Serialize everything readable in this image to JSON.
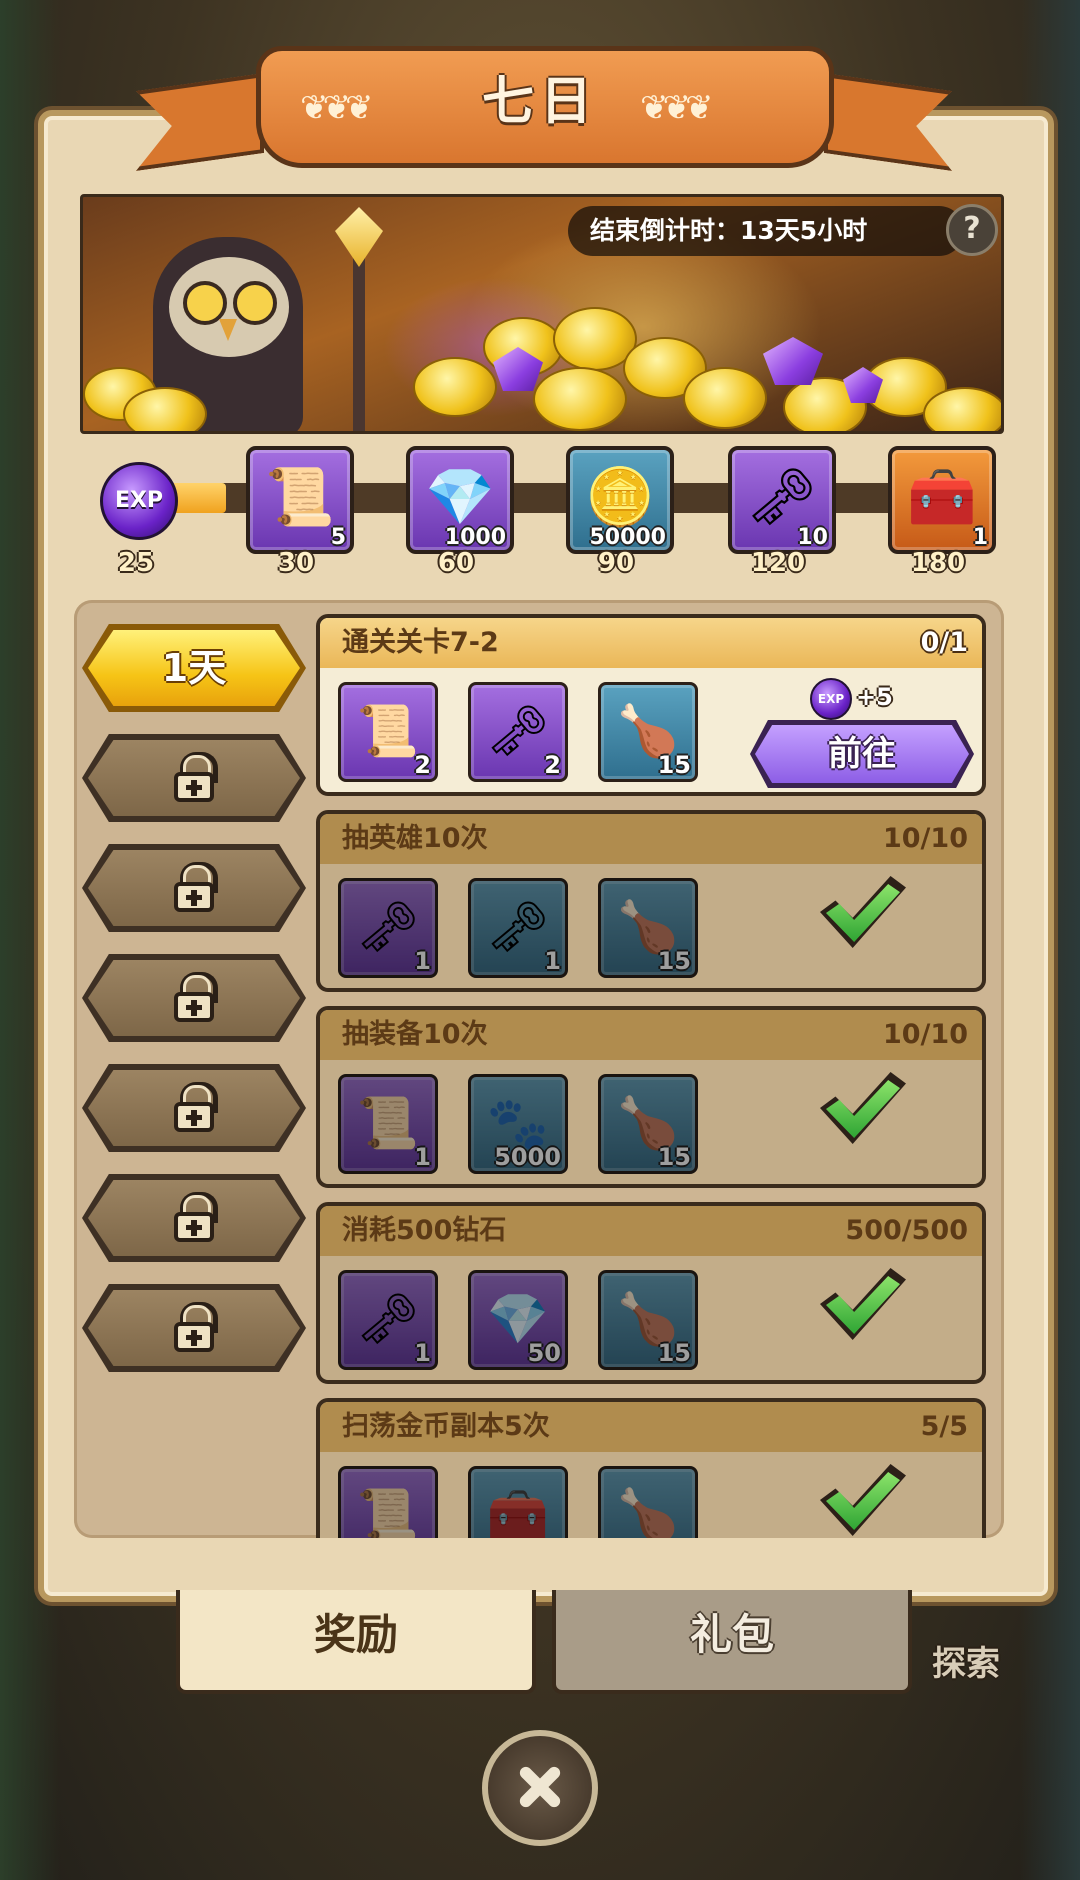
{
  "window": {
    "title": "七日"
  },
  "banner": {
    "countdown_label": "结束倒计时：",
    "countdown_value": "13天5小时",
    "help_icon": "question-mark-icon"
  },
  "progress": {
    "exp_label": "EXP",
    "current_points": 25,
    "fill_fraction": 0.08,
    "milestones": [
      {
        "threshold": "30",
        "icon": "scroll-icon",
        "count": "5",
        "color": "purple"
      },
      {
        "threshold": "60",
        "icon": "purple-gem-icon",
        "count": "1000",
        "color": "purple"
      },
      {
        "threshold": "90",
        "icon": "gold-coin-icon",
        "count": "50000",
        "color": "teal"
      },
      {
        "threshold": "120",
        "icon": "golden-key-icon",
        "count": "10",
        "color": "purple"
      },
      {
        "threshold": "180",
        "icon": "treasure-chest-icon",
        "count": "1",
        "color": "orange"
      }
    ],
    "start_label": "25"
  },
  "days": [
    {
      "label": "1天",
      "state": "active"
    },
    {
      "label": "",
      "state": "locked"
    },
    {
      "label": "",
      "state": "locked"
    },
    {
      "label": "",
      "state": "locked"
    },
    {
      "label": "",
      "state": "locked"
    },
    {
      "label": "",
      "state": "locked"
    },
    {
      "label": "",
      "state": "locked"
    }
  ],
  "quests": [
    {
      "title": "通关关卡7-2",
      "progress": "0/1",
      "state": "active",
      "exp_bonus_label": "EXP",
      "exp_bonus": "+5",
      "button": "前往",
      "rewards": [
        {
          "icon": "scroll-icon",
          "count": "2",
          "color": "purple"
        },
        {
          "icon": "golden-key-icon",
          "count": "2",
          "color": "purple"
        },
        {
          "icon": "meat-drumstick-icon",
          "count": "15",
          "color": "teal"
        }
      ]
    },
    {
      "title": "抽英雄10次",
      "progress": "10/10",
      "state": "done",
      "rewards": [
        {
          "icon": "golden-key-icon",
          "count": "1",
          "color": "purple"
        },
        {
          "icon": "silver-key-icon",
          "count": "1",
          "color": "teal"
        },
        {
          "icon": "meat-drumstick-icon",
          "count": "15",
          "color": "teal"
        }
      ]
    },
    {
      "title": "抽装备10次",
      "progress": "10/10",
      "state": "done",
      "rewards": [
        {
          "icon": "scroll-icon",
          "count": "1",
          "color": "purple"
        },
        {
          "icon": "paw-orb-icon",
          "count": "5000",
          "color": "teal"
        },
        {
          "icon": "meat-drumstick-icon",
          "count": "15",
          "color": "teal"
        }
      ]
    },
    {
      "title": "消耗500钻石",
      "progress": "500/500",
      "state": "done",
      "rewards": [
        {
          "icon": "golden-key-icon",
          "count": "1",
          "color": "purple"
        },
        {
          "icon": "purple-gem-icon",
          "count": "50",
          "color": "purple"
        },
        {
          "icon": "meat-drumstick-icon",
          "count": "15",
          "color": "teal"
        }
      ]
    },
    {
      "title": "扫荡金币副本5次",
      "progress": "5/5",
      "state": "done",
      "rewards": [
        {
          "icon": "scroll-icon",
          "count": "",
          "color": "purple"
        },
        {
          "icon": "treasure-chest-icon",
          "count": "",
          "color": "teal"
        },
        {
          "icon": "meat-drumstick-icon",
          "count": "",
          "color": "teal"
        }
      ]
    }
  ],
  "tabs": {
    "rewards": "奖励",
    "gifts": "礼包"
  },
  "side": {
    "explore": "探索"
  },
  "icons": {
    "close": "close-icon",
    "check": "check-icon",
    "lock": "lock-icon"
  },
  "colors": {
    "accent_gold": "#f6c416",
    "ribbon_orange": "#d9762f",
    "frame_parchment": "#e9d7b4",
    "button_purple": "#8d5ee6",
    "check_green": "#2fa534"
  }
}
